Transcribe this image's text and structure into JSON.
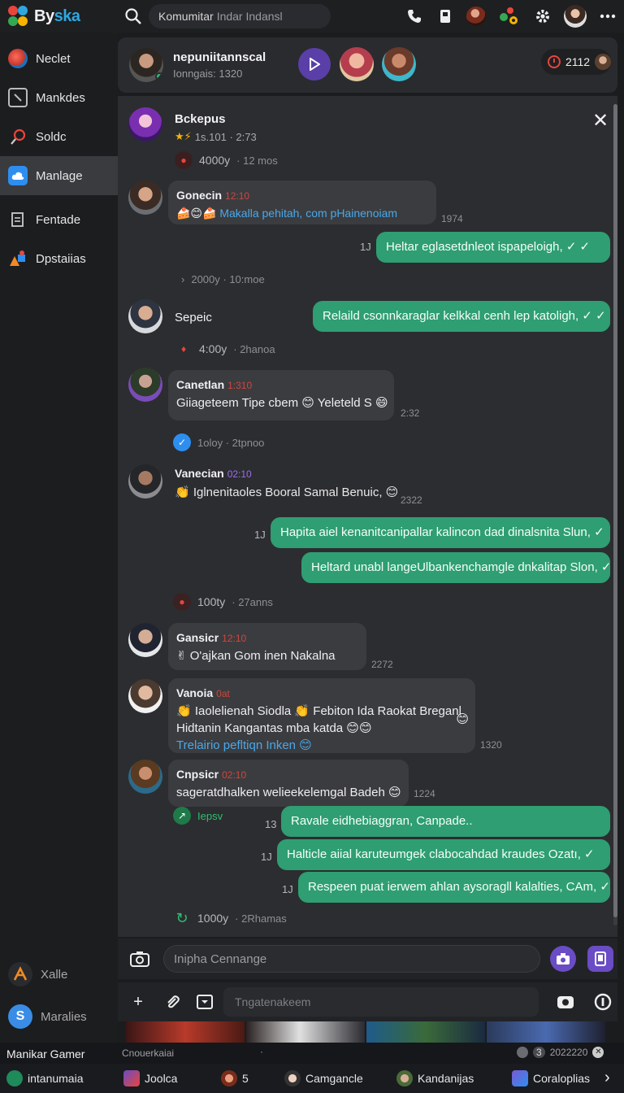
{
  "app": {
    "name": "Byska",
    "name_accent": "ka"
  },
  "search": {
    "value": "Komumitar",
    "muted": "Indar Indansl"
  },
  "sidebar": {
    "items": [
      {
        "label": "Neclet"
      },
      {
        "label": "Mankdes"
      },
      {
        "label": "Soldc"
      },
      {
        "label": "Manlage"
      },
      {
        "label": "Fentade"
      },
      {
        "label": "Dpstaiias"
      }
    ],
    "bottom": [
      {
        "label": "Xalle"
      },
      {
        "label": "Maralies"
      }
    ]
  },
  "chat": {
    "title": "nepuniitannscal",
    "subtitle": "Ionngais: 1320",
    "counter": "2112"
  },
  "panel": {
    "group": {
      "name": "Bckepus",
      "stats": "1s.101 · 2:73"
    }
  },
  "messages": {
    "m1": {
      "meta": "4000y",
      "meta2": "12 mos"
    },
    "m2": {
      "sender": "Gonecin",
      "time": "12:10",
      "text": "Makalla pehitah, com pHainenoiam",
      "ts": "1974"
    },
    "m3": {
      "text": "Heltar  eglasetdnleot ispapeloigh, ✓ ✓",
      "mark": "1J"
    },
    "m4": {
      "meta": "2000y",
      "meta2": "10:moe"
    },
    "m5": {
      "sender": "Sepeic",
      "text": "Relaild csonnkaraglar kelkkal cenh lep katoligh, ✓ ✓"
    },
    "m6": {
      "meta": "4:00y",
      "meta2": "2hanoa"
    },
    "m7": {
      "sender": "Canetlan",
      "time": "1:310",
      "text": "Giiageteem Tipe cbem 😊  Yeleteld S  😄",
      "ts": "2:32"
    },
    "m8": {
      "meta": "1oloy",
      "meta2": "2tpnoo"
    },
    "m9": {
      "sender": "Vanecian",
      "time": "02:10",
      "text": "👏 Iglnenitaoles Booral Samal Benuic, 😊",
      "ts": "2322"
    },
    "m10": {
      "text": "Hapita   aiel kenanitcanipallar kalincon dad dinalsnita Slun, ✓",
      "mark": "1J"
    },
    "m11": {
      "text": "Heltard unabl langeUlbankenchamgle dnkalitap Slon, ✓"
    },
    "m12": {
      "meta": "100ty",
      "meta2": "27anns"
    },
    "m13": {
      "sender": "Gansicr",
      "time": "12:10",
      "text": "✌ O'ajkan Gom inen Nakalna",
      "ts": "2272"
    },
    "m14": {
      "sender": "Vanoia",
      "time": "0at",
      "line1": "👏 Iaolelienah Siodla 👏  Febiton Ida Raokat Breganl",
      "line2": "Hidtanin Kangantas mba katda 😊😊",
      "line3": "Trelairio pefltiqn Inken 😊",
      "ts": "1320"
    },
    "m15": {
      "sender": "Cnpsicr",
      "time": "02:10",
      "text": "sageratdhalken welieekelemgal Badeh 😊",
      "ts": "1224"
    },
    "m16": {
      "meta": "Iepsv"
    },
    "m17": {
      "text": "Ravale   eidhebiaggran, Canpade..",
      "mark": "13"
    },
    "m18": {
      "text": "Halticle   aiial karuteumgek clabocahdad kraudes Ozatı, ✓",
      "mark": "1J"
    },
    "m19": {
      "text": "Respeen puat ierwem ahlan aysoragll kalalties, CAm, ✓",
      "mark": "1J"
    },
    "m20": {
      "meta": "1000y",
      "meta2": "2Rhamas"
    }
  },
  "composer": {
    "placeholder": "Inipha Cennange",
    "tool_placeholder": "Tngatenakeem"
  },
  "statusbar": {
    "left": "Cnouerkaiai",
    "dot": "·",
    "badge": "3",
    "right": "2022220"
  },
  "taskbar": {
    "user_line1": "Manikar Gamer",
    "user_line2": "intanumaia",
    "items": [
      {
        "label": "Joolca"
      },
      {
        "label": "5"
      },
      {
        "label": "Camgancle"
      },
      {
        "label": "Kandanijas"
      },
      {
        "label": "Coraloplias"
      }
    ]
  },
  "colors": {
    "accent_green": "#2f9e72",
    "accent_purple": "#6a4cc4",
    "link_blue": "#4aa8e8",
    "time_red": "#d0463b"
  }
}
